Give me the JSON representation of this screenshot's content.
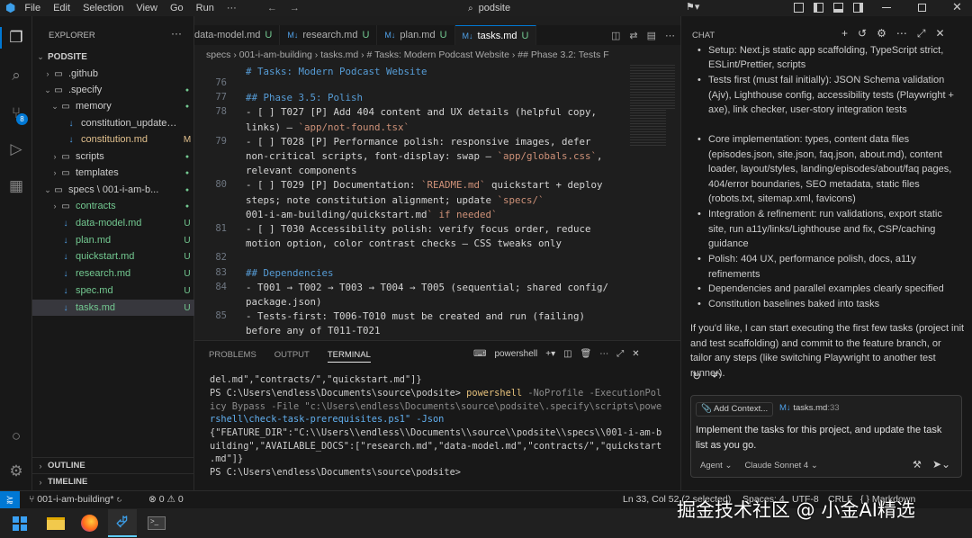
{
  "titlebar": {
    "menu": [
      "File",
      "Edit",
      "Selection",
      "View",
      "Go",
      "Run",
      "···"
    ],
    "search": "podsite"
  },
  "explorer": {
    "title": "EXPLORER",
    "more": "···",
    "root": "PODSITE",
    "rows": [
      {
        "label": ".github",
        "badge": ""
      },
      {
        "label": ".specify",
        "badge": "●"
      },
      {
        "label": "memory",
        "badge": "●"
      },
      {
        "label": "constitution_update_c...",
        "badge": ""
      },
      {
        "label": "constitution.md",
        "badge": "M"
      },
      {
        "label": "scripts",
        "badge": "●"
      },
      {
        "label": "templates",
        "badge": "●"
      },
      {
        "label": "specs \\ 001-i-am-b...",
        "badge": "●"
      },
      {
        "label": "contracts",
        "badge": "●"
      },
      {
        "label": "data-model.md",
        "badge": "U"
      },
      {
        "label": "plan.md",
        "badge": "U"
      },
      {
        "label": "quickstart.md",
        "badge": "U"
      },
      {
        "label": "research.md",
        "badge": "U"
      },
      {
        "label": "spec.md",
        "badge": "U"
      },
      {
        "label": "tasks.md",
        "badge": "U"
      }
    ],
    "outline": "OUTLINE",
    "timeline": "TIMELINE"
  },
  "tabs": [
    {
      "label": "data-model.md",
      "status": "U"
    },
    {
      "label": "research.md",
      "status": "U"
    },
    {
      "label": "plan.md",
      "status": "U"
    },
    {
      "label": "tasks.md",
      "status": "U"
    }
  ],
  "breadcrumb": "specs › 001-i-am-building ›  tasks.md › # Tasks: Modern Podcast Website › ## Phase 3.2: Tests F",
  "editor": {
    "sticky": "# Tasks: Modern Podcast Website",
    "line_numbers": [
      "76",
      "77",
      "78",
      "",
      "79",
      "",
      "",
      "80",
      "",
      "",
      "81",
      "",
      "82",
      "83",
      "84",
      "",
      "85",
      ""
    ],
    "lines": [
      "",
      "## Phase 3.5: Polish",
      "- [ ] T027 [P] Add 404 content and UX details (helpful copy,",
      "links) — `app/not-found.tsx`",
      "- [ ] T028 [P] Performance polish: responsive images, defer",
      "non-critical scripts, font-display: swap — `app/globals.css`,",
      "relevant components",
      "- [ ] T029 [P] Documentation: `README.md` quickstart + deploy",
      "steps; note constitution alignment; update `specs/",
      "001-i-am-building/quickstart.md` if needed",
      "- [ ] T030 Accessibility polish: verify focus order, reduce",
      "motion option, color contrast checks — CSS tweaks only",
      "",
      "## Dependencies",
      "- T001 → T002 → T003 → T004 → T005 (sequential; shared config/",
      "package.json)",
      "- Tests-first: T006-T010 must be created and run (failing)",
      "before any of T011-T021"
    ]
  },
  "panel": {
    "tabs": [
      "PROBLEMS",
      "OUTPUT",
      "TERMINAL"
    ],
    "shell": "powershell",
    "lines": [
      "del.md\",\"contracts/\",\"quickstart.md\"]}",
      "PS C:\\Users\\endless\\Documents\\source\\podsite> ",
      "icy Bypass -File \"c:\\Users\\endless\\Documents\\source\\podsite\\.specify\\scripts\\powe",
      "rshell\\check-task-prerequisites.ps1\" -Json",
      "{\"FEATURE_DIR\":\"C:\\\\Users\\\\endless\\\\Documents\\\\source\\\\podsite\\\\specs\\\\001-i-am-b",
      "uilding\",\"AVAILABLE_DOCS\":[\"research.md\",\"data-model.md\",\"contracts/\",\"quickstart",
      ".md\"]}",
      "PS C:\\Users\\endless\\Documents\\source\\podsite> "
    ],
    "cmd1": "powershell",
    "cmd1_args": " -NoProfile -ExecutionPol"
  },
  "chat": {
    "title": "CHAT",
    "top_line": "Setup: Next.js static app scaffolding, TypeScript strict,",
    "bullets": [
      "ESLint/Prettier, scripts",
      "Tests first (must fail initially): JSON Schema validation (Ajv), Lighthouse config, accessibility tests (Playwright + axe), link checker, user-story integration tests",
      "Core implementation: types, content data files (episodes.json, site.json, faq.json, about.md), content loader, layout/styles, landing/episodes/about/faq pages, 404/error boundaries, SEO metadata, static files (robots.txt, sitemap.xml, favicons)",
      "Integration & refinement: run validations, export static site, run a11y/links/Lighthouse and fix, CSP/caching guidance",
      "Polish: 404 UX, performance polish, docs, a11y refinements",
      "Dependencies and parallel examples clearly specified",
      "Constitution baselines baked into tasks"
    ],
    "closing": "If you'd like, I can start executing the first few tasks (project init and test scaffolding) and commit to the feature branch, or tailor any steps (like switching Playwright to another test runner).",
    "add_context": "Add Context...",
    "context_file": "tasks.md",
    "context_line": ":33",
    "input": "Implement the tasks for this project, and update the task list as you go.",
    "mode": "Agent",
    "model": "Claude Sonnet 4"
  },
  "status": {
    "branch": "001-i-am-building*",
    "errors": "0",
    "warnings": "0",
    "position": "Ln 33, Col 52 (2 selected)",
    "spaces": "Spaces: 4",
    "encoding": "UTF-8",
    "eol": "CRLF",
    "lang": "{ } Markdown"
  },
  "watermark": "掘金技术社区 @ 小金AI精选"
}
